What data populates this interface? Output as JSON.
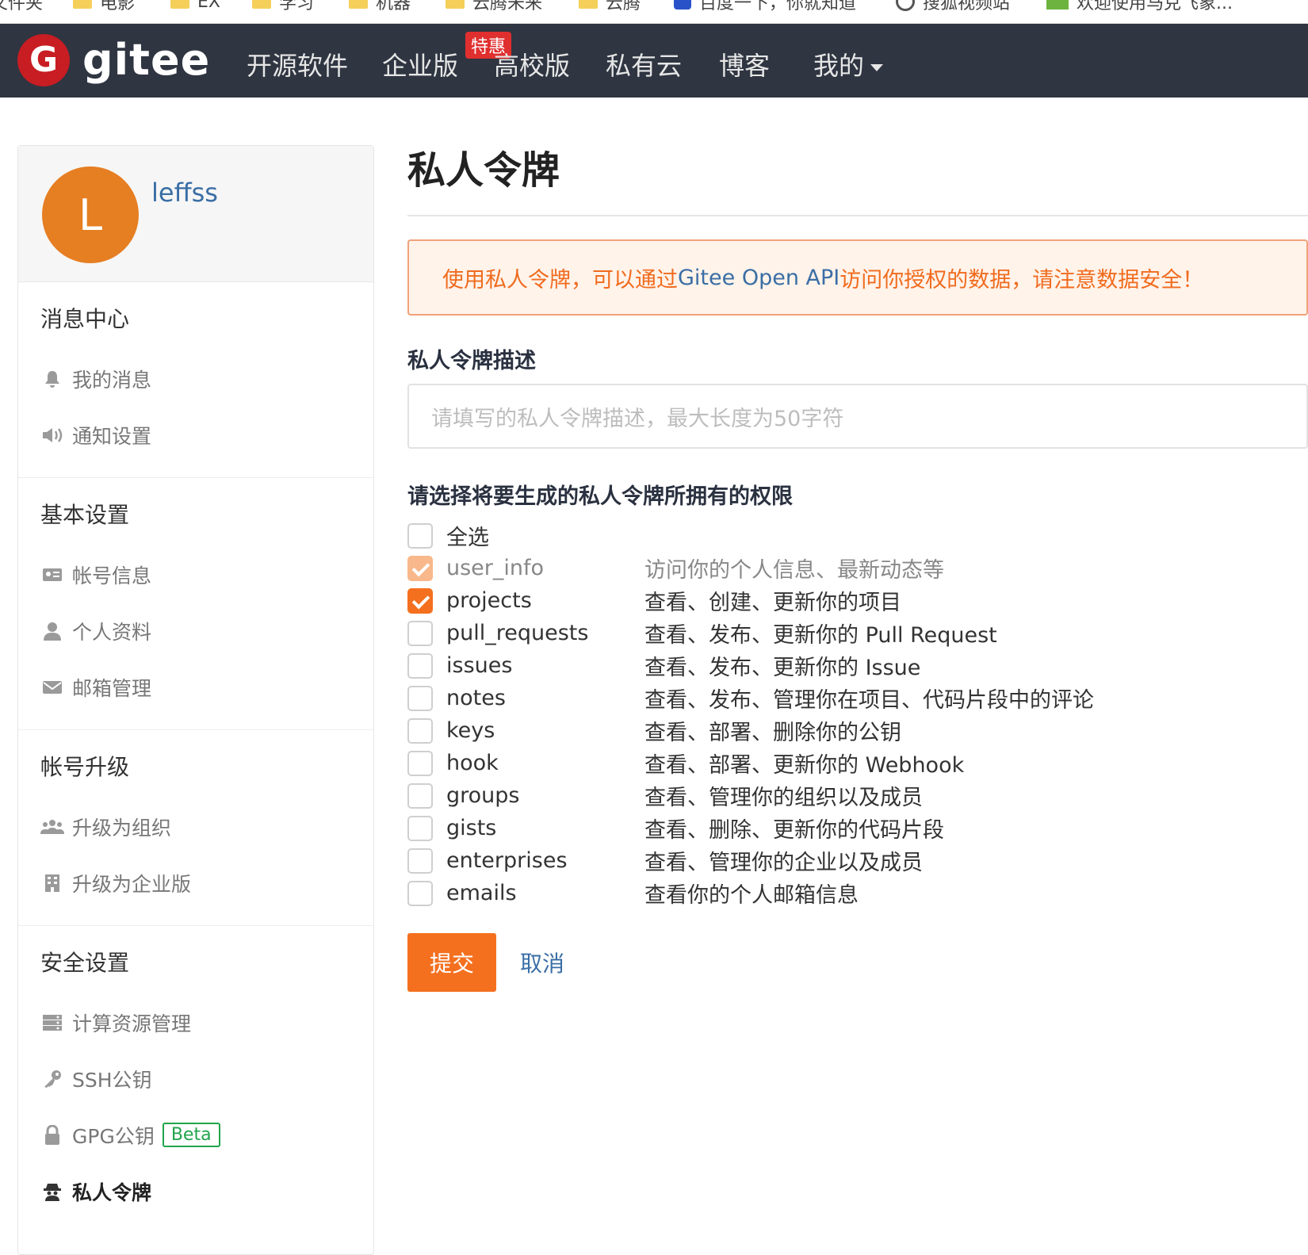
{
  "bookmarks": [
    {
      "label": "文件夹",
      "icon": "folder-icon"
    },
    {
      "label": "电影",
      "icon": "folder-icon"
    },
    {
      "label": "EX",
      "icon": "folder-icon"
    },
    {
      "label": "学习",
      "icon": "folder-icon"
    },
    {
      "label": "机器",
      "icon": "folder-icon"
    },
    {
      "label": "云腾未来",
      "icon": "folder-icon"
    },
    {
      "label": "云腾",
      "icon": "folder-icon"
    },
    {
      "label": "百度一下，你就知道",
      "icon": "baidu-icon"
    },
    {
      "label": "搜狐视频站",
      "icon": "globe-icon"
    },
    {
      "label": "欢迎使用马克飞象...",
      "icon": "app-icon"
    }
  ],
  "nav": {
    "logo_mark": "G",
    "logo_text": "gitee",
    "items": [
      "开源软件",
      "企业版",
      "高校版",
      "私有云",
      "博客",
      "我的"
    ],
    "badge": "特惠"
  },
  "profile": {
    "avatar_letter": "L",
    "username": "leffss"
  },
  "sidebar": {
    "sections": [
      {
        "title": "消息中心",
        "items": [
          {
            "label": "我的消息",
            "icon": "bell-icon"
          },
          {
            "label": "通知设置",
            "icon": "speaker-icon"
          }
        ]
      },
      {
        "title": "基本设置",
        "items": [
          {
            "label": "帐号信息",
            "icon": "id-card-icon"
          },
          {
            "label": "个人资料",
            "icon": "user-icon"
          },
          {
            "label": "邮箱管理",
            "icon": "envelope-icon"
          }
        ]
      },
      {
        "title": "帐号升级",
        "items": [
          {
            "label": "升级为组织",
            "icon": "users-icon"
          },
          {
            "label": "升级为企业版",
            "icon": "building-icon"
          }
        ]
      },
      {
        "title": "安全设置",
        "items": [
          {
            "label": "计算资源管理",
            "icon": "server-icon"
          },
          {
            "label": "SSH公钥",
            "icon": "key-icon"
          },
          {
            "label": "GPG公钥",
            "icon": "lock-icon",
            "badge": "Beta"
          },
          {
            "label": "私人令牌",
            "icon": "spy-icon",
            "active": true
          }
        ]
      }
    ]
  },
  "main": {
    "title": "私人令牌",
    "alert": {
      "before": "使用私人令牌，可以通过 ",
      "api": "Gitee Open API",
      "after": " 访问你授权的数据，请注意数据安全！"
    },
    "desc_label": "私人令牌描述",
    "desc_placeholder": "请填写的私人令牌描述，最大长度为50字符",
    "perm_label": "请选择将要生成的私人令牌所拥有的权限",
    "select_all": "全选",
    "permissions": [
      {
        "name": "user_info",
        "desc": "访问你的个人信息、最新动态等",
        "checked": true,
        "disabled": true
      },
      {
        "name": "projects",
        "desc": "查看、创建、更新你的项目",
        "checked": true
      },
      {
        "name": "pull_requests",
        "desc": "查看、发布、更新你的 Pull Request",
        "checked": false
      },
      {
        "name": "issues",
        "desc": "查看、发布、更新你的 Issue",
        "checked": false
      },
      {
        "name": "notes",
        "desc": "查看、发布、管理你在项目、代码片段中的评论",
        "checked": false
      },
      {
        "name": "keys",
        "desc": "查看、部署、删除你的公钥",
        "checked": false
      },
      {
        "name": "hook",
        "desc": "查看、部署、更新你的 Webhook",
        "checked": false
      },
      {
        "name": "groups",
        "desc": "查看、管理你的组织以及成员",
        "checked": false
      },
      {
        "name": "gists",
        "desc": "查看、删除、更新你的代码片段",
        "checked": false
      },
      {
        "name": "enterprises",
        "desc": "查看、管理你的企业以及成员",
        "checked": false
      },
      {
        "name": "emails",
        "desc": "查看你的个人邮箱信息",
        "checked": false
      }
    ],
    "submit": "提交",
    "cancel": "取消"
  },
  "colors": {
    "accent": "#f4701f",
    "nav_bg": "#2f3541",
    "link": "#3a6ea5",
    "avatar": "#e67e22",
    "beta": "#21a44b"
  }
}
